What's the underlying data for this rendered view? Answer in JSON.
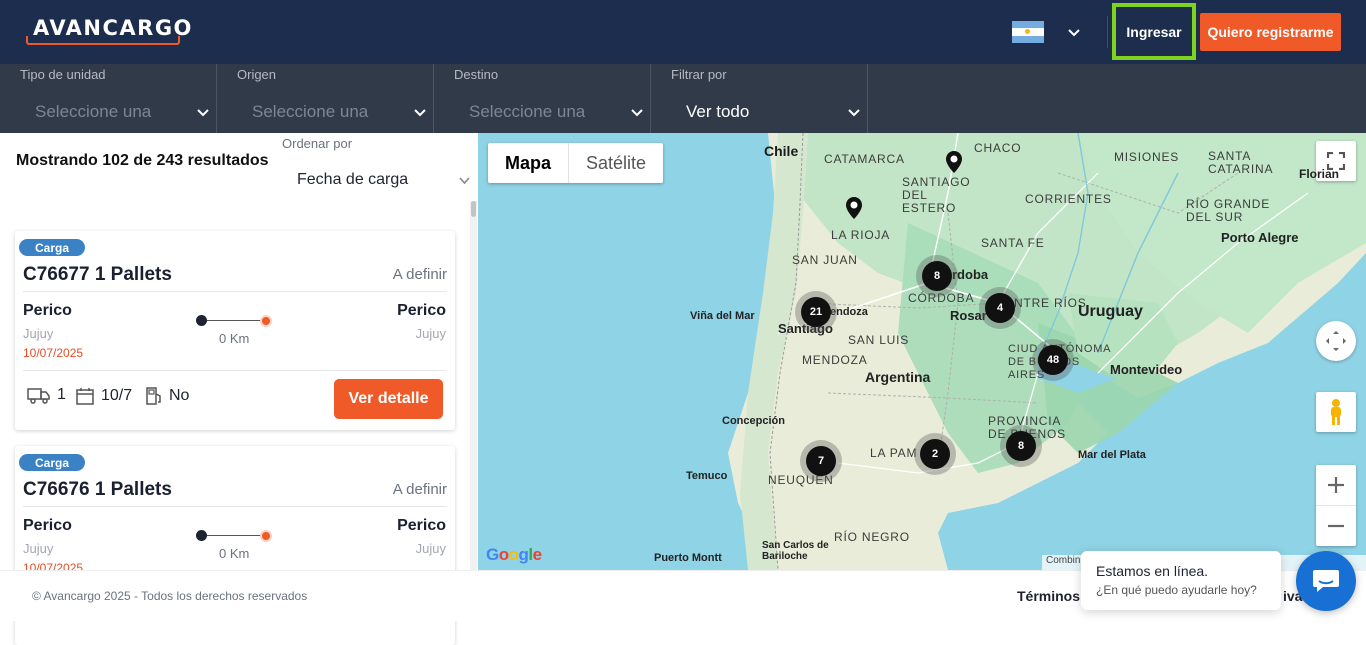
{
  "header": {
    "logo_text": "AVANCARGO",
    "login_label": "Ingresar",
    "register_label": "Quiero registrarme"
  },
  "filters": [
    {
      "label": "Tipo de unidad",
      "value": "Seleccione una"
    },
    {
      "label": "Origen",
      "value": "Seleccione una"
    },
    {
      "label": "Destino",
      "value": "Seleccione una"
    },
    {
      "label": "Filtrar por",
      "value": "Ver todo"
    }
  ],
  "results": {
    "count_text": "Mostrando 102 de 243 resultados",
    "sort_label": "Ordenar por",
    "sort_value": "Fecha de carga"
  },
  "cards": [
    {
      "badge": "Carga",
      "title": "C76677 1 Pallets",
      "price": "A definir",
      "origin_city": "Perico",
      "origin_prov": "Jujuy",
      "dest_city": "Perico",
      "dest_prov": "Jujuy",
      "date": "10/07/2025",
      "distance": "0 Km",
      "units": "1",
      "short_date": "10/7",
      "extra": "No",
      "button": "Ver detalle"
    },
    {
      "badge": "Carga",
      "title": "C76676 1 Pallets",
      "price": "A definir",
      "origin_city": "Perico",
      "origin_prov": "Jujuy",
      "dest_city": "Perico",
      "dest_prov": "Jujuy",
      "date": "10/07/2025",
      "distance": "0 Km"
    }
  ],
  "map": {
    "type_map": "Mapa",
    "type_satellite": "Satélite",
    "labels": {
      "chile": "Chile",
      "catamarca": "CATAMARCA",
      "chaco": "CHACO",
      "misiones": "MISIONES",
      "santa_catarina": "SANTA CATARINA",
      "florian": "Florian",
      "santiago_estero": "SANTIAGO DEL ESTERO",
      "corrientes": "CORRIENTES",
      "rio_grande_sul": "RÍO GRANDE DEL SUR",
      "la_rioja": "LA RIOJA",
      "santa_fe": "SANTA FE",
      "porto_alegre": "Porto Alegre",
      "san_juan": "SAN JUAN",
      "cordoba_city": "rdoba",
      "cordoba": "CÓRDOBA",
      "entre_rios": "NTRE RÍOS",
      "uruguay": "Uruguay",
      "vina": "Viña del Mar",
      "mendoza_city": "endoza",
      "santiago": "Santiago",
      "rosario": "Rosar",
      "san_luis": "SAN LUIS",
      "caba": "CIUD AUTÓNOMA DE BUENOS AIRES",
      "montevideo": "Montevideo",
      "mendoza": "MENDOZA",
      "argentina": "Argentina",
      "concepcion": "Concepción",
      "provincia_ba": "PROVINCIA DE BUENOS",
      "la_pampa": "LA PAM",
      "mar_plata": "Mar del Plata",
      "temuco": "Temuco",
      "neuquen": "NEUQUEN",
      "bariloche": "San Carlos de Bariloche",
      "rio_negro": "RÍO NEGRO",
      "puerto_montt": "Puerto Montt",
      "google": "Google",
      "attribution": "Combin"
    },
    "clusters": [
      {
        "count": "8"
      },
      {
        "count": "21"
      },
      {
        "count": "4"
      },
      {
        "count": "48"
      },
      {
        "count": "7"
      },
      {
        "count": "2"
      },
      {
        "count": "8"
      }
    ]
  },
  "footer": {
    "copyright": "© Avancargo 2025 - Todos los derechos reservados",
    "terms": "Términos y",
    "privacy": "iva"
  },
  "chat": {
    "line1": "Estamos en línea.",
    "line2": "¿En qué puedo ayudarle hoy?"
  },
  "colors": {
    "header_bg": "#1d2d4d",
    "filter_bg": "#313a48",
    "accent": "#f05a28",
    "login_border": "#7ed321",
    "badge": "#3b82c4",
    "chat": "#1870d5"
  }
}
